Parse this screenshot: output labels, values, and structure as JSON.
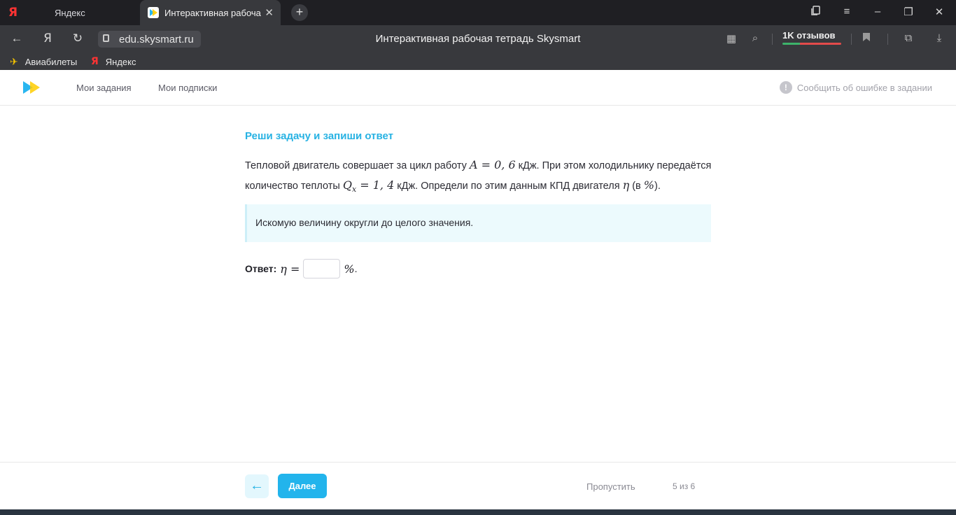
{
  "browser": {
    "tabs": [
      {
        "label": "Яндекс"
      },
      {
        "label": "Интерактивная рабоча"
      }
    ],
    "new_tab": "+",
    "url": "edu.skysmart.ru",
    "title": "Интерактивная рабочая тетрадь Skysmart",
    "reviews": "1K отзывов",
    "bookmarks": [
      {
        "label": "Авиабилеты"
      },
      {
        "label": "Яндекс"
      }
    ]
  },
  "site": {
    "nav": [
      "Мои задания",
      "Мои подписки"
    ],
    "report": "Сообщить об ошибке в задании"
  },
  "task": {
    "title": "Реши задачу и запиши ответ",
    "text_1": "Тепловой двигатель совершает за цикл работу ",
    "math_a": "A = 0, 6",
    "text_2": " кДж. При этом холодильнику передаётся количество теплоты ",
    "math_q_var": "Q",
    "math_q_sub": "x",
    "math_q_rest": " = 1, 4",
    "text_3": " кДж. Определи по этим данным КПД двигателя ",
    "math_eta": "η",
    "text_4": " (в ",
    "math_pct": "%",
    "text_5": ").",
    "hint": "Искомую величину округли до целого значения.",
    "answer_label": "Ответ:",
    "answer_math": "η =",
    "answer_value": "",
    "answer_unit": "%",
    "answer_dot": "."
  },
  "footer": {
    "next": "Далее",
    "skip": "Пропустить",
    "counter": "5 из 6"
  }
}
